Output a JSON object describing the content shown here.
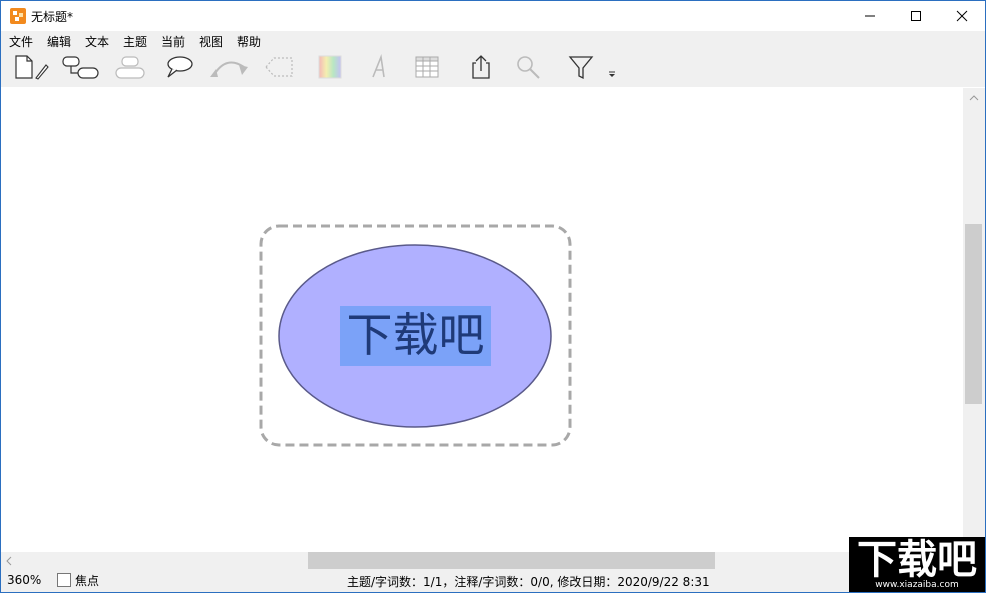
{
  "window": {
    "title": "无标题*"
  },
  "menu": [
    "文件",
    "编辑",
    "文本",
    "主题",
    "当前",
    "视图",
    "帮助"
  ],
  "toolbar": {
    "icons": [
      "new-document-icon",
      "add-subtopic-icon",
      "add-sibling-icon",
      "callout-icon",
      "relationship-icon",
      "boundary-icon",
      "color-icon",
      "font-icon",
      "table-icon",
      "export-icon",
      "search-icon",
      "filter-icon",
      "more-icon"
    ]
  },
  "topic": {
    "label": "下载吧",
    "fill": "#b0b0ff",
    "highlight": "#7ba2f8",
    "boundary": "#a8a8a8"
  },
  "status": {
    "zoom": "360%",
    "focus_label": "焦点",
    "info": "主题/字词数：1/1，注释/字词数：0/0, 修改日期：2020/9/22 8:31"
  },
  "watermark": {
    "logo": "下载吧",
    "url": "www.xiazaiba.com"
  }
}
